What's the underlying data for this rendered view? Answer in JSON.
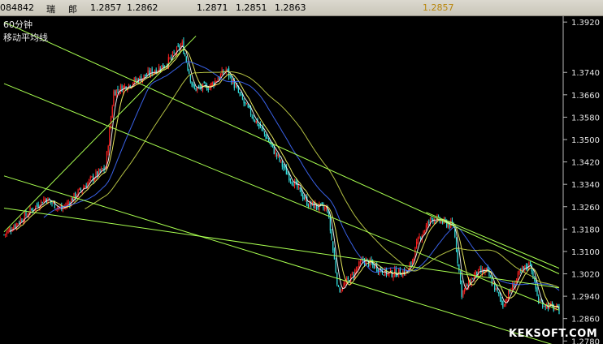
{
  "header": {
    "code": "084842",
    "name_1": "瑞",
    "name_2": "郎",
    "open": "1.2857",
    "high": "1.2862",
    "prev": "1.2871",
    "low": "1.2851",
    "close": "1.2863",
    "last": "1.2857",
    "last_color": "#b8860b"
  },
  "chart_data": {
    "type": "candlestick",
    "period": "60分钟",
    "indicator": "移动平均线",
    "watermark": "KEKSOFT.COM",
    "ylim": [
      1.2775,
      1.3935
    ],
    "y_ticks": [
      1.392,
      1.374,
      1.366,
      1.358,
      1.35,
      1.342,
      1.334,
      1.326,
      1.318,
      1.31,
      1.302,
      1.294,
      1.286,
      1.278
    ],
    "price_path": [
      {
        "i": 0,
        "p": 1.316
      },
      {
        "i": 18,
        "p": 1.324
      },
      {
        "i": 30,
        "p": 1.329
      },
      {
        "i": 42,
        "p": 1.325
      },
      {
        "i": 52,
        "p": 1.33
      },
      {
        "i": 64,
        "p": 1.336
      },
      {
        "i": 74,
        "p": 1.34
      },
      {
        "i": 80,
        "p": 1.367
      },
      {
        "i": 100,
        "p": 1.372
      },
      {
        "i": 118,
        "p": 1.377
      },
      {
        "i": 130,
        "p": 1.384
      },
      {
        "i": 138,
        "p": 1.368
      },
      {
        "i": 150,
        "p": 1.369
      },
      {
        "i": 162,
        "p": 1.375
      },
      {
        "i": 175,
        "p": 1.363
      },
      {
        "i": 190,
        "p": 1.352
      },
      {
        "i": 205,
        "p": 1.339
      },
      {
        "i": 222,
        "p": 1.327
      },
      {
        "i": 236,
        "p": 1.325
      },
      {
        "i": 244,
        "p": 1.296
      },
      {
        "i": 252,
        "p": 1.3
      },
      {
        "i": 262,
        "p": 1.307
      },
      {
        "i": 280,
        "p": 1.302
      },
      {
        "i": 295,
        "p": 1.303
      },
      {
        "i": 303,
        "p": 1.315
      },
      {
        "i": 312,
        "p": 1.322
      },
      {
        "i": 328,
        "p": 1.319
      },
      {
        "i": 334,
        "p": 1.295
      },
      {
        "i": 344,
        "p": 1.302
      },
      {
        "i": 352,
        "p": 1.303
      },
      {
        "i": 364,
        "p": 1.291
      },
      {
        "i": 376,
        "p": 1.302
      },
      {
        "i": 384,
        "p": 1.306
      },
      {
        "i": 390,
        "p": 1.292
      },
      {
        "i": 405,
        "p": 1.289
      }
    ],
    "candle_count": 406,
    "ma_periods": [
      5,
      10,
      30,
      60
    ],
    "ma_colors": [
      "#ffffff",
      "#ffff66",
      "#3f6bff",
      "#c8d64a"
    ],
    "up_color": "#ff2020",
    "down_color": "#33e0e0",
    "trendlines": [
      {
        "x1": 0,
        "y1": 1.392,
        "x2": 405,
        "y2": 1.302
      },
      {
        "x1": 0,
        "y1": 1.37,
        "x2": 405,
        "y2": 1.289
      },
      {
        "x1": 0,
        "y1": 1.337,
        "x2": 405,
        "y2": 1.276
      },
      {
        "x1": 0,
        "y1": 1.3255,
        "x2": 405,
        "y2": 1.297
      },
      {
        "x1": 308,
        "y1": 1.324,
        "x2": 405,
        "y2": 1.304
      },
      {
        "x1": 0,
        "y1": 1.317,
        "x2": 140,
        "y2": 1.387
      }
    ],
    "trendline_color": "#a8ff50",
    "grid": false,
    "border_color": "#b8b8b8"
  }
}
